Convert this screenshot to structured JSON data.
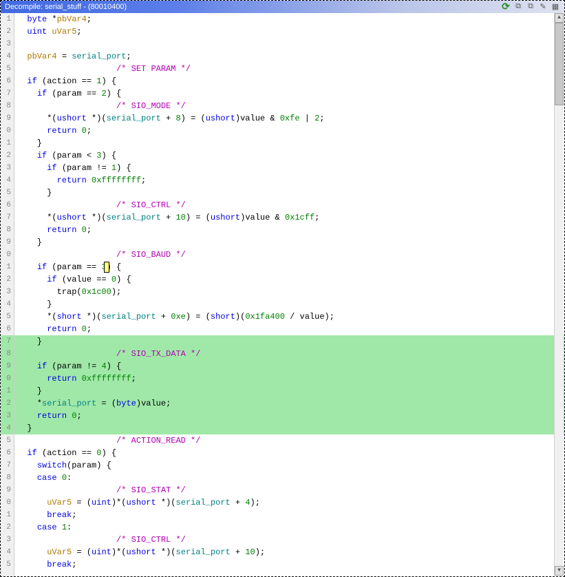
{
  "title": "Decompile: serial_stuff - (80010400)",
  "linesStart": 1,
  "highlightStart": 27,
  "highlightEnd": 34,
  "cursorLine": 21,
  "cursorCol": 18,
  "code": [
    [
      [
        "  "
      ],
      [
        "ty",
        "byte"
      ],
      [
        " *"
      ],
      [
        "var",
        "pbVar4"
      ],
      [
        ";"
      ]
    ],
    [
      [
        "  "
      ],
      [
        "ty",
        "uint"
      ],
      [
        " "
      ],
      [
        "var",
        "uVar5"
      ],
      [
        ";"
      ]
    ],
    [
      [
        "  "
      ]
    ],
    [
      [
        "  "
      ],
      [
        "var",
        "pbVar4"
      ],
      [
        " = "
      ],
      [
        "glob",
        "serial_port"
      ],
      [
        ";"
      ]
    ],
    [
      [
        "                    "
      ],
      [
        "cm",
        "/* SET PARAM */"
      ]
    ],
    [
      [
        "  "
      ],
      [
        "kw",
        "if"
      ],
      [
        " ("
      ],
      [
        "id",
        "action"
      ],
      [
        " == "
      ],
      [
        "num",
        "1"
      ],
      [
        ") {"
      ]
    ],
    [
      [
        "    "
      ],
      [
        "kw",
        "if"
      ],
      [
        " ("
      ],
      [
        "id",
        "param"
      ],
      [
        " == "
      ],
      [
        "num",
        "2"
      ],
      [
        ") {"
      ]
    ],
    [
      [
        "                    "
      ],
      [
        "cm",
        "/* SIO_MODE */"
      ]
    ],
    [
      [
        "      *("
      ],
      [
        "ty",
        "ushort"
      ],
      [
        " *)("
      ],
      [
        "glob",
        "serial_port"
      ],
      [
        " + "
      ],
      [
        "num",
        "8"
      ],
      [
        ") = ("
      ],
      [
        "ty",
        "ushort"
      ],
      [
        ")"
      ],
      [
        "id",
        "value"
      ],
      [
        " & "
      ],
      [
        "num",
        "0xfe"
      ],
      [
        " | "
      ],
      [
        "num",
        "2"
      ],
      [
        ";"
      ]
    ],
    [
      [
        "      "
      ],
      [
        "kw",
        "return"
      ],
      [
        " "
      ],
      [
        "num",
        "0"
      ],
      [
        ";"
      ]
    ],
    [
      [
        "    }"
      ]
    ],
    [
      [
        "    "
      ],
      [
        "kw",
        "if"
      ],
      [
        " ("
      ],
      [
        "id",
        "param"
      ],
      [
        " < "
      ],
      [
        "num",
        "3"
      ],
      [
        ") {"
      ]
    ],
    [
      [
        "      "
      ],
      [
        "kw",
        "if"
      ],
      [
        " ("
      ],
      [
        "id",
        "param"
      ],
      [
        " != "
      ],
      [
        "num",
        "1"
      ],
      [
        ") {"
      ]
    ],
    [
      [
        "        "
      ],
      [
        "kw",
        "return"
      ],
      [
        " "
      ],
      [
        "num",
        "0xffffffff"
      ],
      [
        ";"
      ]
    ],
    [
      [
        "      }"
      ]
    ],
    [
      [
        "                    "
      ],
      [
        "cm",
        "/* SIO_CTRL */"
      ]
    ],
    [
      [
        "      *("
      ],
      [
        "ty",
        "ushort"
      ],
      [
        " *)("
      ],
      [
        "glob",
        "serial_port"
      ],
      [
        " + "
      ],
      [
        "num",
        "10"
      ],
      [
        ") = ("
      ],
      [
        "ty",
        "ushort"
      ],
      [
        ")"
      ],
      [
        "id",
        "value"
      ],
      [
        " & "
      ],
      [
        "num",
        "0x1cff"
      ],
      [
        ";"
      ]
    ],
    [
      [
        "      "
      ],
      [
        "kw",
        "return"
      ],
      [
        " "
      ],
      [
        "num",
        "0"
      ],
      [
        ";"
      ]
    ],
    [
      [
        "    }"
      ]
    ],
    [
      [
        "                    "
      ],
      [
        "cm",
        "/* SIO_BAUD */"
      ]
    ],
    [
      [
        "    "
      ],
      [
        "kw",
        "if"
      ],
      [
        " ("
      ],
      [
        "id",
        "param"
      ],
      [
        " == "
      ],
      [
        "num",
        "3"
      ],
      [
        ") {"
      ]
    ],
    [
      [
        "      "
      ],
      [
        "kw",
        "if"
      ],
      [
        " ("
      ],
      [
        "id",
        "value"
      ],
      [
        " == "
      ],
      [
        "num",
        "0"
      ],
      [
        ") {"
      ]
    ],
    [
      [
        "        "
      ],
      [
        "fn",
        "trap"
      ],
      [
        "("
      ],
      [
        "num",
        "0x1c00"
      ],
      [
        ");"
      ]
    ],
    [
      [
        "      }"
      ]
    ],
    [
      [
        "      *("
      ],
      [
        "ty",
        "short"
      ],
      [
        " *)("
      ],
      [
        "glob",
        "serial_port"
      ],
      [
        " + "
      ],
      [
        "num",
        "0xe"
      ],
      [
        ") = ("
      ],
      [
        "ty",
        "short"
      ],
      [
        ")("
      ],
      [
        "num",
        "0x1fa400"
      ],
      [
        " / "
      ],
      [
        "id",
        "value"
      ],
      [
        ");"
      ]
    ],
    [
      [
        "      "
      ],
      [
        "kw",
        "return"
      ],
      [
        " "
      ],
      [
        "num",
        "0"
      ],
      [
        ";"
      ]
    ],
    [
      [
        "    }"
      ]
    ],
    [
      [
        "                    "
      ],
      [
        "cm",
        "/* SIO_TX_DATA */"
      ]
    ],
    [
      [
        "    "
      ],
      [
        "kw",
        "if"
      ],
      [
        " ("
      ],
      [
        "id",
        "param"
      ],
      [
        " != "
      ],
      [
        "num",
        "4"
      ],
      [
        ") {"
      ]
    ],
    [
      [
        "      "
      ],
      [
        "kw",
        "return"
      ],
      [
        " "
      ],
      [
        "num",
        "0xffffffff"
      ],
      [
        ";"
      ]
    ],
    [
      [
        "    }"
      ]
    ],
    [
      [
        "    *"
      ],
      [
        "glob",
        "serial_port"
      ],
      [
        " = ("
      ],
      [
        "ty",
        "byte"
      ],
      [
        ")"
      ],
      [
        "id",
        "value"
      ],
      [
        ";"
      ]
    ],
    [
      [
        "    "
      ],
      [
        "kw",
        "return"
      ],
      [
        " "
      ],
      [
        "num",
        "0"
      ],
      [
        ";"
      ]
    ],
    [
      [
        "  }"
      ]
    ],
    [
      [
        "                    "
      ],
      [
        "cm",
        "/* ACTION_READ */"
      ]
    ],
    [
      [
        "  "
      ],
      [
        "kw",
        "if"
      ],
      [
        " ("
      ],
      [
        "id",
        "action"
      ],
      [
        " == "
      ],
      [
        "num",
        "0"
      ],
      [
        ") {"
      ]
    ],
    [
      [
        "    "
      ],
      [
        "kw",
        "switch"
      ],
      [
        "("
      ],
      [
        "id",
        "param"
      ],
      [
        ") {"
      ]
    ],
    [
      [
        "    "
      ],
      [
        "kw",
        "case"
      ],
      [
        " "
      ],
      [
        "num",
        "0"
      ],
      [
        ":"
      ]
    ],
    [
      [
        "                    "
      ],
      [
        "cm",
        "/* SIO_STAT */"
      ]
    ],
    [
      [
        "      "
      ],
      [
        "var",
        "uVar5"
      ],
      [
        " = ("
      ],
      [
        "ty",
        "uint"
      ],
      [
        ")*("
      ],
      [
        "ty",
        "ushort"
      ],
      [
        " *)("
      ],
      [
        "glob",
        "serial_port"
      ],
      [
        " + "
      ],
      [
        "num",
        "4"
      ],
      [
        ");"
      ]
    ],
    [
      [
        "      "
      ],
      [
        "kw",
        "break"
      ],
      [
        ";"
      ]
    ],
    [
      [
        "    "
      ],
      [
        "kw",
        "case"
      ],
      [
        " "
      ],
      [
        "num",
        "1"
      ],
      [
        ":"
      ]
    ],
    [
      [
        "                    "
      ],
      [
        "cm",
        "/* SIO_CTRL */"
      ]
    ],
    [
      [
        "      "
      ],
      [
        "var",
        "uVar5"
      ],
      [
        " = ("
      ],
      [
        "ty",
        "uint"
      ],
      [
        ")*("
      ],
      [
        "ty",
        "ushort"
      ],
      [
        " *)("
      ],
      [
        "glob",
        "serial_port"
      ],
      [
        " + "
      ],
      [
        "num",
        "10"
      ],
      [
        ");"
      ]
    ],
    [
      [
        "      "
      ],
      [
        "kw",
        "break"
      ],
      [
        ";"
      ]
    ]
  ]
}
